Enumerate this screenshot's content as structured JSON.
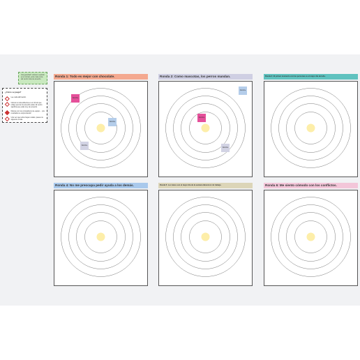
{
  "intro_note": {
    "text": "Una guía fácil: coloca tu opinión en el círculo, entre más cerca del centro más de acuerdo."
  },
  "howto": {
    "title": "¿Cómo se juega?",
    "steps": [
      {
        "text": "Lee cada afirmación."
      },
      {
        "text": "Coloca tu nota adhesiva en el círculo que refleje qué tan de acuerdo estás. El centro significa que estás muy de acuerdo."
      },
      {
        "text": "Discute con tus compañeros de equipo… ¡los resultados te sorprenderán!"
      },
      {
        "text": "Una vez que todos hayan votado, pasa a la siguiente ronda."
      }
    ]
  },
  "colors": {
    "orange": "#f4a98f",
    "lavender": "#cfcfe3",
    "teal": "#5fc2bf",
    "blue": "#a9c9ec",
    "khaki": "#dcd5b8",
    "pink": "#f3c6d9",
    "bullseye": "#fdeea9",
    "sticky_pink": "#e5509a",
    "sticky_blue": "#b4cdea",
    "sticky_lavender": "#d2d3e4"
  },
  "panels": [
    {
      "title": "Ronda 1: Todo es mejor con chocolate.",
      "color": "orange",
      "stickies": [
        {
          "label": "Nombre",
          "color": "sticky_pink"
        },
        {
          "label": "Nombre",
          "color": "sticky_blue"
        },
        {
          "label": "Nombre",
          "color": "sticky_lavender"
        }
      ]
    },
    {
      "title": "Ronda 2: Como mascotas, los perros mandan.",
      "color": "lavender",
      "stickies": [
        {
          "label": "Nombre",
          "color": "sticky_blue"
        },
        {
          "label": "Nombre",
          "color": "sticky_pink"
        },
        {
          "label": "Nombre",
          "color": "sticky_lavender"
        }
      ]
    },
    {
      "title": "Ronda 3: El primer momento con las personas es el mejor día del año.",
      "color": "teal",
      "stickies": []
    },
    {
      "title": "Ronda 4: No me preocupa pedir ayuda a los demás.",
      "color": "blue",
      "stickies": []
    },
    {
      "title": "Ronda 5: Los lunes son el mejor día de la semana laboral en mi trabajo.",
      "color": "khaki",
      "stickies": []
    },
    {
      "title": "Ronda 6: Me siento cómodo con los conflictos.",
      "color": "pink",
      "stickies": []
    }
  ]
}
